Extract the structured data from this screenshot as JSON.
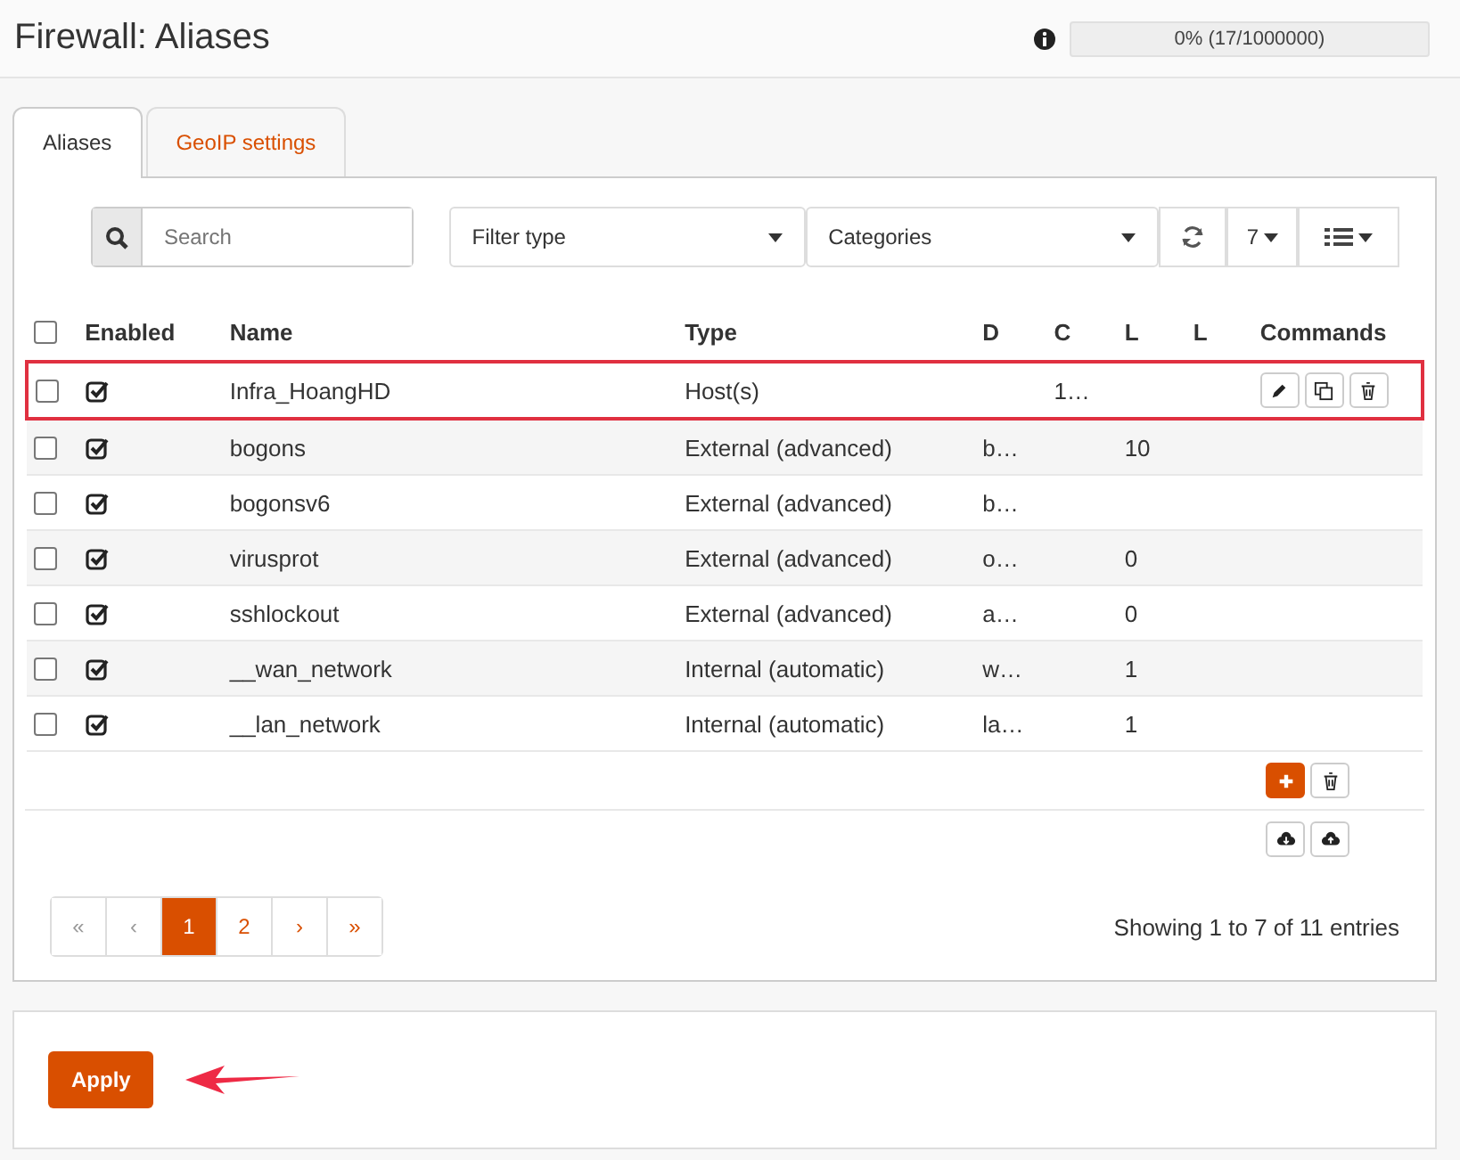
{
  "header": {
    "title": "Firewall: Aliases",
    "usage": "0% (17/1000000)"
  },
  "tabs": [
    {
      "label": "Aliases",
      "selected": true
    },
    {
      "label": "GeoIP settings",
      "selected": false
    }
  ],
  "toolbar": {
    "search_placeholder": "Search",
    "filter_type": "Filter type",
    "categories": "Categories",
    "page_size": "7"
  },
  "table": {
    "select_all": false,
    "columns": [
      "Enabled",
      "Name",
      "Type",
      "D",
      "C",
      "L",
      "L",
      "Commands"
    ],
    "rows": [
      {
        "selected": false,
        "enabled": true,
        "name": "Infra_HoangHD",
        "type": "Host(s)",
        "d": "",
        "c": "1…",
        "l1": "",
        "l2": "",
        "show_commands": true,
        "outlined": true
      },
      {
        "selected": false,
        "enabled": true,
        "name": "bogons",
        "type": "External (advanced)",
        "d": "b…",
        "c": "",
        "l1": "10",
        "l2": "",
        "show_commands": false,
        "outlined": false
      },
      {
        "selected": false,
        "enabled": true,
        "name": "bogonsv6",
        "type": "External (advanced)",
        "d": "b…",
        "c": "",
        "l1": "",
        "l2": "",
        "show_commands": false,
        "outlined": false
      },
      {
        "selected": false,
        "enabled": true,
        "name": "virusprot",
        "type": "External (advanced)",
        "d": "o…",
        "c": "",
        "l1": "0",
        "l2": "",
        "show_commands": false,
        "outlined": false
      },
      {
        "selected": false,
        "enabled": true,
        "name": "sshlockout",
        "type": "External (advanced)",
        "d": "a…",
        "c": "",
        "l1": "0",
        "l2": "",
        "show_commands": false,
        "outlined": false
      },
      {
        "selected": false,
        "enabled": true,
        "name": "__wan_network",
        "type": "Internal (automatic)",
        "d": "w…",
        "c": "",
        "l1": "1",
        "l2": "",
        "show_commands": false,
        "outlined": false
      },
      {
        "selected": false,
        "enabled": true,
        "name": "__lan_network",
        "type": "Internal (automatic)",
        "d": "la…",
        "c": "",
        "l1": "1",
        "l2": "",
        "show_commands": false,
        "outlined": false
      }
    ]
  },
  "pagination": {
    "pages": [
      {
        "label": "«",
        "selected": false
      },
      {
        "label": "‹",
        "selected": false
      },
      {
        "label": "1",
        "selected": true
      },
      {
        "label": "2",
        "selected": false
      },
      {
        "label": "›",
        "selected": false
      },
      {
        "label": "»",
        "selected": false
      }
    ],
    "info": "Showing 1 to 7 of 11 entries"
  },
  "apply": {
    "label": "Apply",
    "arrow": true
  }
}
